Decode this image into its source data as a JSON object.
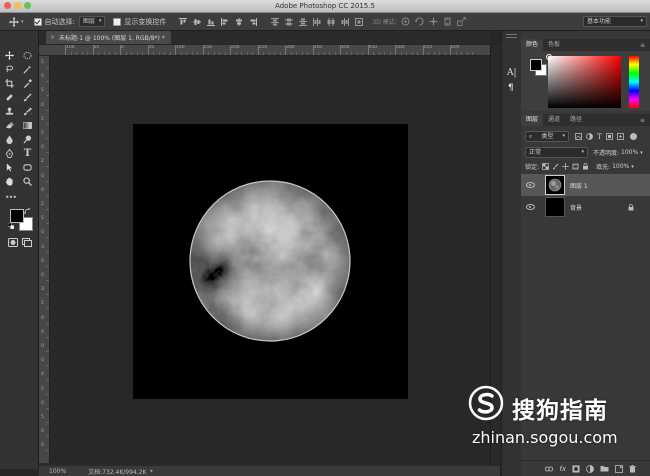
{
  "window": {
    "title": "Adobe Photoshop CC 2015.5"
  },
  "options_bar": {
    "auto_select_label": "自动选择:",
    "auto_select_value": "图层",
    "show_transform_label": "显示变换控件",
    "mode_3d_label": "3D 模式:",
    "workspace": "基本功能"
  },
  "document_tab": {
    "label": "未标题-1 @ 100% (图层 1, RGB/8*) *"
  },
  "ruler_h_ticks": [
    "100",
    "50",
    "0",
    "50",
    "100",
    "150",
    "200",
    "250",
    "300",
    "350",
    "400",
    "450",
    "500",
    "550",
    "600"
  ],
  "ruler_v_ticks": [
    "5",
    "0",
    "5",
    "0",
    "1",
    "5",
    "0",
    "2",
    "0",
    "0",
    "2",
    "5",
    "0",
    "3",
    "0",
    "0",
    "3",
    "5",
    "0",
    "4",
    "0",
    "0",
    "4",
    "5",
    "0",
    "5",
    "0",
    "0"
  ],
  "status_bar": {
    "zoom": "100%",
    "doc_info": "文档:732.4K/994.2K"
  },
  "color_panel": {
    "tabs": [
      "颜色",
      "色板"
    ]
  },
  "layers_panel": {
    "tabs": [
      "图层",
      "通道",
      "路径"
    ],
    "filter_kind": "类型",
    "blend_mode": "正常",
    "opacity_label": "不透明度:",
    "opacity_value": "100%",
    "lock_label": "锁定:",
    "fill_label": "填充:",
    "fill_value": "100%",
    "layers": [
      {
        "name": "图层 1"
      },
      {
        "name": "背景"
      }
    ]
  },
  "watermark": {
    "brand": "搜狗指南",
    "url": "zhinan.sogou.com"
  }
}
